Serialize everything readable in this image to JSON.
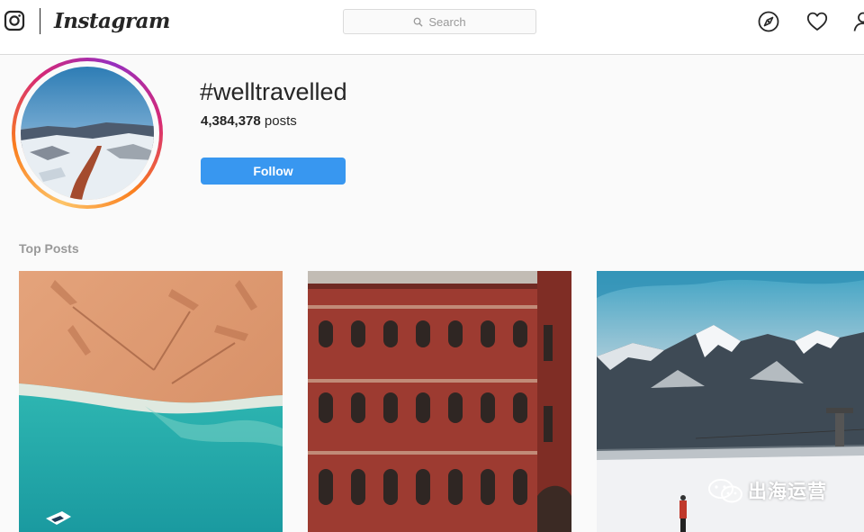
{
  "nav": {
    "brand": "Instagram",
    "search_placeholder": "Search",
    "icons": [
      "instagram-camera-icon",
      "compass-icon",
      "heart-icon",
      "profile-icon"
    ]
  },
  "header": {
    "hashtag": "#welltravelled",
    "post_count": "4,384,378",
    "post_count_label": " posts",
    "follow_label": "Follow"
  },
  "sections": {
    "top_posts_label": "Top Posts"
  },
  "posts": [
    {
      "subject": "aerial beach with palm tree shadows"
    },
    {
      "subject": "red brick gothic building"
    },
    {
      "subject": "snowy mountains with skier"
    }
  ],
  "watermark": {
    "text": "出海运营"
  },
  "colors": {
    "accent": "#3897f0",
    "muted_text": "#999999",
    "border": "#dbdbdb"
  }
}
